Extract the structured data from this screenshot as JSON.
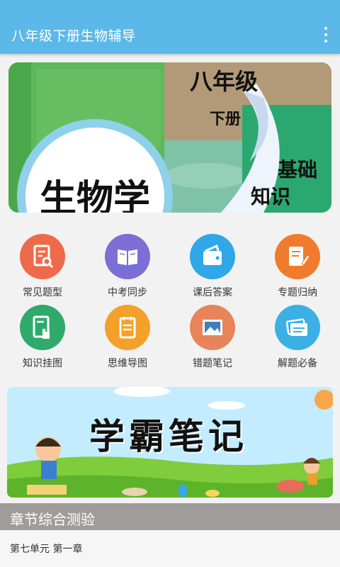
{
  "appbar": {
    "title": "八年级下册生物辅导",
    "menu_icon": "more-vert-icon"
  },
  "banner": {
    "grade": "八年级",
    "volume": "下册",
    "subject": "生物学",
    "caption_line1": "基础",
    "caption_line2": "知识"
  },
  "grid": {
    "items": [
      {
        "label": "常见题型",
        "icon": "document-search-icon",
        "color": "#ef6a4a"
      },
      {
        "label": "中考同步",
        "icon": "open-book-icon",
        "color": "#7b6fd6"
      },
      {
        "label": "课后答案",
        "icon": "wallet-icon",
        "color": "#2fa7e8"
      },
      {
        "label": "专题归纳",
        "icon": "note-pen-icon",
        "color": "#f07b2c"
      },
      {
        "label": "知识挂图",
        "icon": "tap-document-icon",
        "color": "#2faa6b"
      },
      {
        "label": "思维导图",
        "icon": "notepad-icon",
        "color": "#f5a02a"
      },
      {
        "label": "错题笔记",
        "icon": "picture-icon",
        "color": "#e8845a"
      },
      {
        "label": "解题必备",
        "icon": "cards-icon",
        "color": "#3ab0e6"
      }
    ]
  },
  "ad": {
    "title": "学霸笔记"
  },
  "section": {
    "title": "章节综合测验"
  },
  "chapters": [
    {
      "label": "第七单元 第一章"
    }
  ]
}
